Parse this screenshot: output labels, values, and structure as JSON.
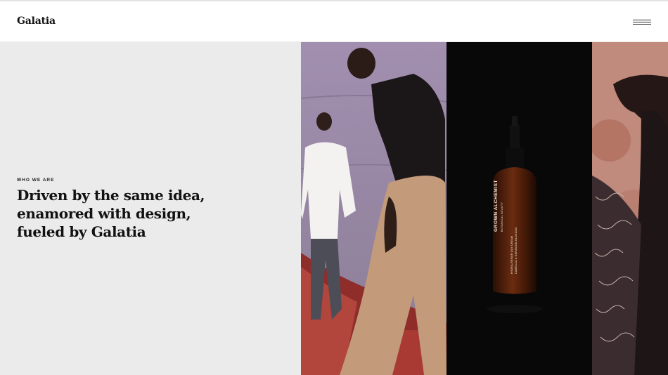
{
  "header": {
    "logo": "Galatia",
    "menu_icon": "hamburger-menu-icon"
  },
  "hero": {
    "eyebrow": "WHO WE ARE",
    "headline_lines": [
      "Driven by the same idea,",
      "enamored with design,",
      "fueled by Galatia"
    ]
  },
  "gallery": {
    "bottle": {
      "brand": "GROWN ALCHEMIST",
      "sub": "BOTANICAL BEAUTY",
      "product_line1": "HYDRA-REPAIR DAY CREAM",
      "product_line2": "CAMELLIA & GERANIUM BLOSSOM"
    }
  },
  "colors": {
    "left_bg": "#ebebeb",
    "text": "#111111",
    "photo1_bg": "#8f7f98",
    "photo2_bg": "#070807",
    "photo3_bg": "#c08a7c"
  }
}
